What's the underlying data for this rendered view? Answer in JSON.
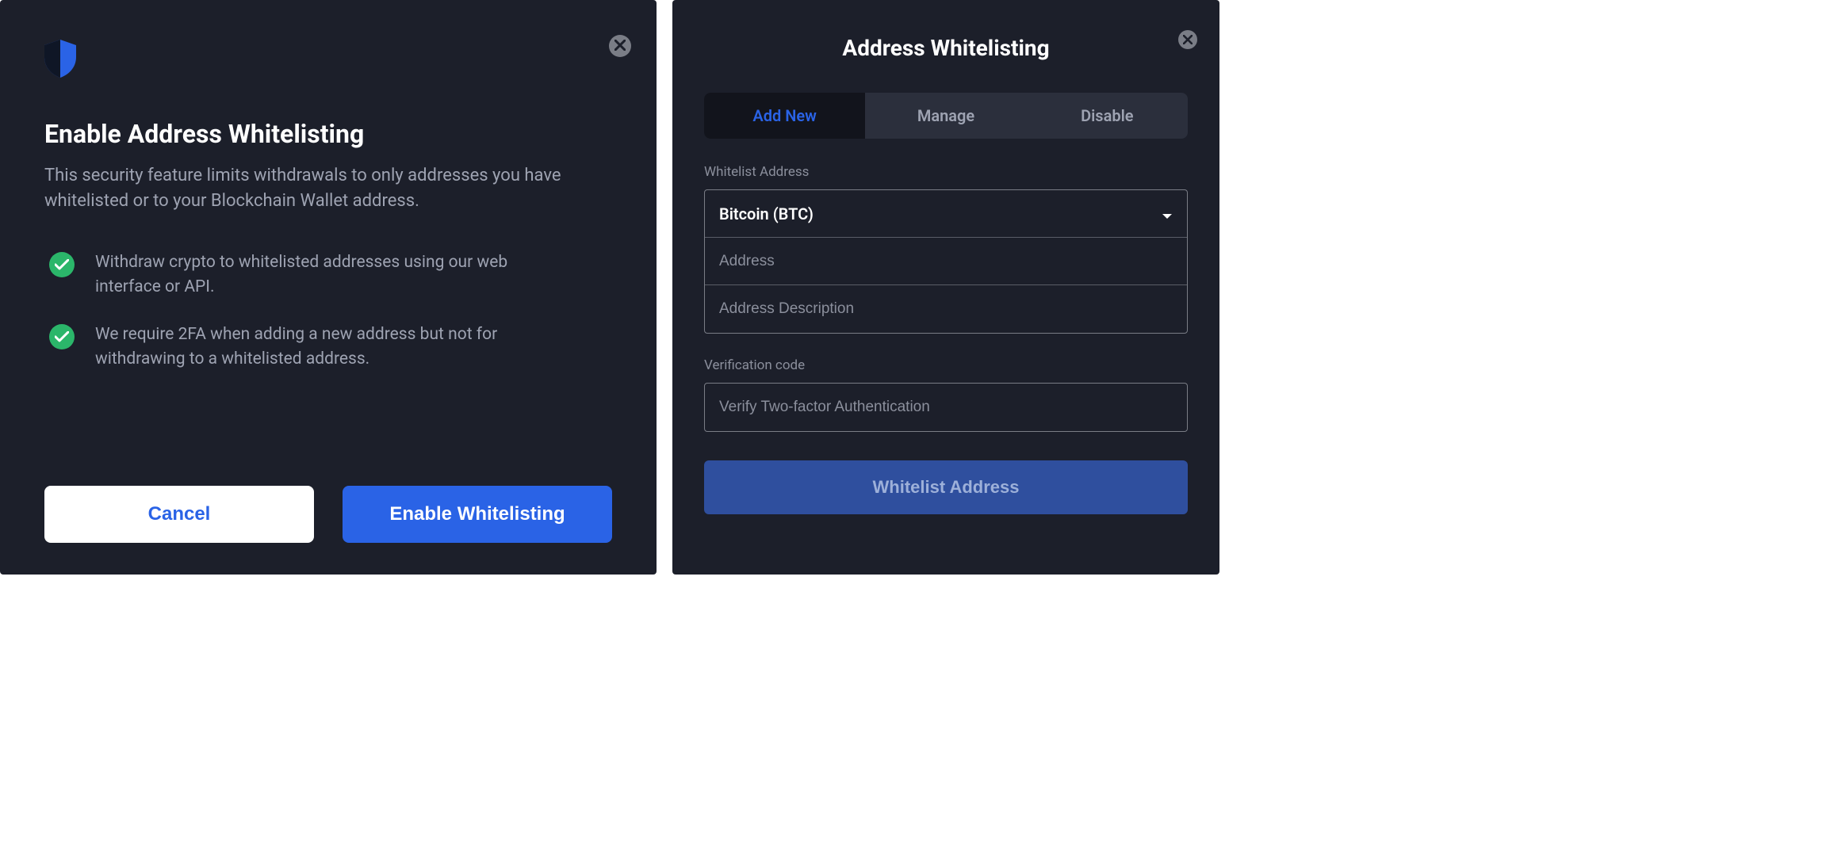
{
  "left": {
    "title": "Enable Address Whitelisting",
    "subtitle": "This security feature limits withdrawals to only addresses you have whitelisted or to your Blockchain Wallet address.",
    "features": [
      "Withdraw crypto to whitelisted addresses using our web interface or API.",
      "We require 2FA when adding a new address but not for withdrawing to a whitelisted address."
    ],
    "cancel_label": "Cancel",
    "enable_label": "Enable Whitelisting"
  },
  "right": {
    "title": "Address Whitelisting",
    "tabs": [
      {
        "label": "Add New",
        "active": true
      },
      {
        "label": "Manage",
        "active": false
      },
      {
        "label": "Disable",
        "active": false
      }
    ],
    "whitelist_label": "Whitelist Address",
    "currency_selected": "Bitcoin (BTC)",
    "address_placeholder": "Address",
    "description_placeholder": "Address Description",
    "verification_label": "Verification code",
    "verification_placeholder": "Verify Two-factor Authentication",
    "submit_label": "Whitelist Address"
  }
}
